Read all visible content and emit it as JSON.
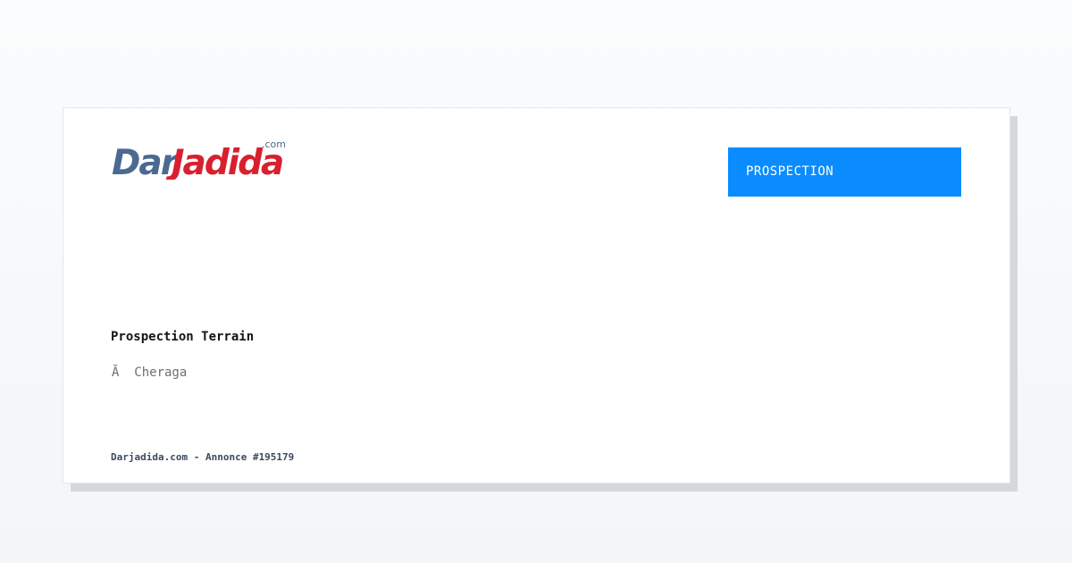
{
  "logo": {
    "part1": "Dar",
    "part2": "Jadida",
    "suffix": ".com",
    "color_part1": "#4b6a92",
    "color_part2": "#d8202f"
  },
  "badge": {
    "label": "PROSPECTION",
    "color": "#0a8cff"
  },
  "listing": {
    "title": "Prospection Terrain",
    "location": "Ã  Cheraga"
  },
  "footer": {
    "text": "Darjadida.com - Annonce #195179"
  }
}
